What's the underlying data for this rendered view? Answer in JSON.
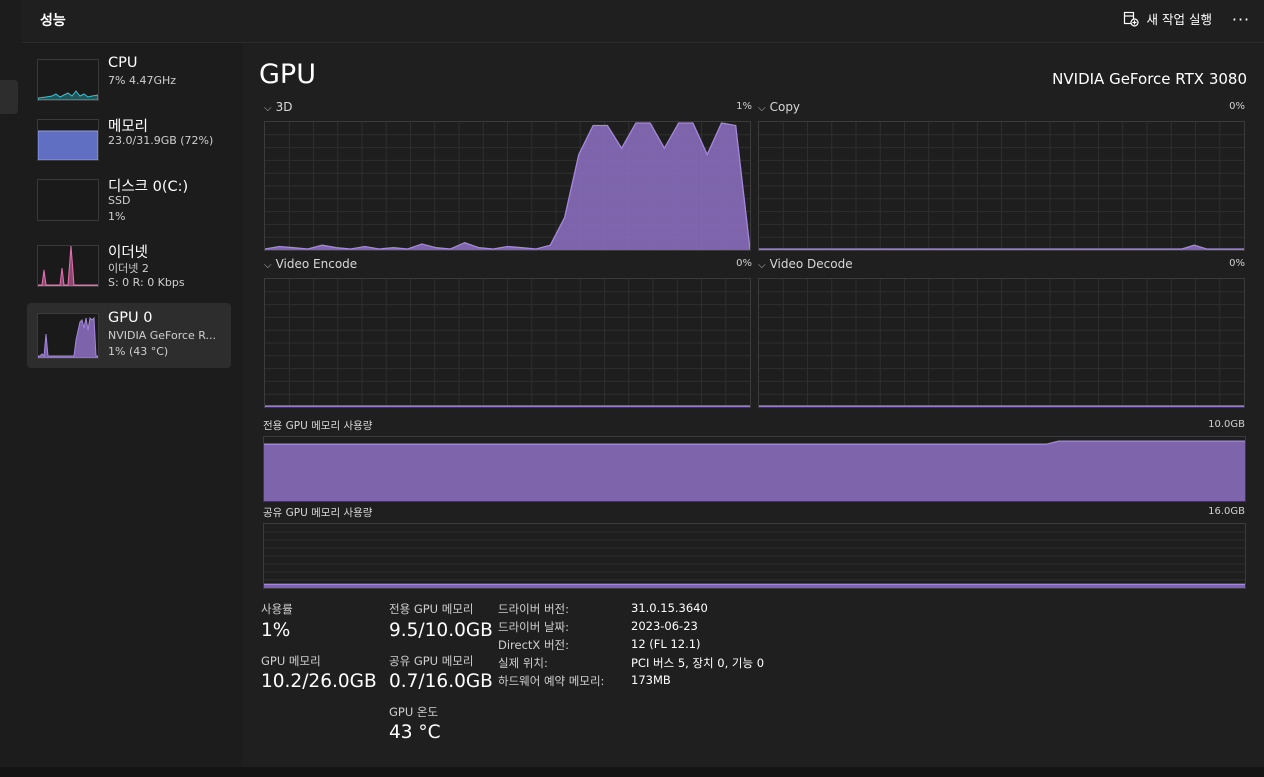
{
  "header": {
    "title": "성능",
    "run_new_task_label": "새 작업 실행",
    "more_label": "···"
  },
  "sidebar": {
    "items": [
      {
        "name": "CPU",
        "sub1": "7% 4.47GHz",
        "sub2": "",
        "color": "#35c3d0"
      },
      {
        "name": "메모리",
        "sub1": "23.0/31.9GB (72%)",
        "sub2": "",
        "color": "#6e7fe0"
      },
      {
        "name": "디스크 0(C:)",
        "sub1": "SSD",
        "sub2": "1%",
        "color": "#6abf4b"
      },
      {
        "name": "이더넷",
        "sub1": "이더넷 2",
        "sub2": "S: 0 R: 0 Kbps",
        "color": "#e96fb4"
      },
      {
        "name": "GPU 0",
        "sub1": "NVIDIA GeForce R...",
        "sub2": "1% (43 °C)",
        "color": "#a07ad8",
        "selected": true
      }
    ]
  },
  "main": {
    "title": "GPU",
    "model": "NVIDIA GeForce RTX 3080",
    "engines": [
      {
        "label": "3D",
        "percent": "1%"
      },
      {
        "label": "Copy",
        "percent": "0%"
      },
      {
        "label": "Video Encode",
        "percent": "0%"
      },
      {
        "label": "Video Decode",
        "percent": "0%"
      }
    ],
    "dedicated_memory": {
      "label": "전용 GPU 메모리 사용량",
      "max": "10.0GB"
    },
    "shared_memory": {
      "label": "공유 GPU 메모리 사용량",
      "max": "16.0GB"
    }
  },
  "stats": {
    "utilization": {
      "label": "사용률",
      "value": "1%"
    },
    "gpu_memory": {
      "label": "GPU 메모리",
      "value": "10.2/26.0GB"
    },
    "dedicated": {
      "label": "전용 GPU 메모리",
      "value": "9.5/10.0GB"
    },
    "shared": {
      "label": "공유 GPU 메모리",
      "value": "0.7/16.0GB"
    },
    "temperature": {
      "label": "GPU 온도",
      "value": "43 °C"
    }
  },
  "info": [
    {
      "key": "드라이버 버전:",
      "value": "31.0.15.3640"
    },
    {
      "key": "드라이버 날짜:",
      "value": "2023-06-23"
    },
    {
      "key": "DirectX 버전:",
      "value": "12 (FL 12.1)"
    },
    {
      "key": "실제 위치:",
      "value": "PCI 버스 5, 장치 0, 기능 0"
    },
    {
      "key": "하드웨어 예약 메모리:",
      "value": "173MB"
    }
  ],
  "colors": {
    "gpu_fill": "#8e71c4",
    "gpu_line": "#a586e0",
    "grid": "#2e2e2e",
    "background": "#1f1f1f"
  },
  "chart_data": [
    {
      "type": "area",
      "series": [
        {
          "name": "3D",
          "values": [
            0,
            2,
            1,
            0,
            3,
            1,
            0,
            2,
            0,
            1,
            0,
            4,
            1,
            0,
            5,
            1,
            0,
            2,
            1,
            0,
            3,
            25,
            75,
            98,
            98,
            80,
            100,
            100,
            80,
            100,
            100,
            75,
            100,
            98,
            0
          ]
        }
      ],
      "ylim": [
        0,
        100
      ]
    },
    {
      "type": "area",
      "series": [
        {
          "name": "Copy",
          "values": [
            0,
            0,
            0,
            0,
            0,
            0,
            0,
            0,
            0,
            0,
            0,
            0,
            0,
            0,
            0,
            0,
            0,
            0,
            0,
            0,
            0,
            0,
            0,
            0,
            0,
            0,
            0,
            0,
            0,
            0,
            0,
            0,
            0,
            0,
            0,
            3,
            0,
            0,
            0,
            0
          ]
        }
      ],
      "ylim": [
        0,
        100
      ]
    },
    {
      "type": "area",
      "series": [
        {
          "name": "Video Encode",
          "values": [
            0,
            0
          ]
        }
      ],
      "ylim": [
        0,
        100
      ]
    },
    {
      "type": "area",
      "series": [
        {
          "name": "Video Decode",
          "values": [
            0,
            0
          ]
        }
      ],
      "ylim": [
        0,
        100
      ]
    },
    {
      "type": "area",
      "series": [
        {
          "name": "전용 GPU 메모리 사용량",
          "values": [
            9.0,
            9.0,
            9.0,
            9.0,
            9.0,
            9.0,
            9.0,
            9.0,
            9.0,
            9.0,
            9.0,
            9.0,
            9.0,
            9.0,
            9.0,
            9.0,
            9.0,
            9.0,
            9.0,
            9.0,
            9.0,
            9.0,
            9.0,
            9.0,
            9.0,
            9.0,
            9.0,
            9.0,
            9.0,
            9.0,
            9.0,
            9.0,
            9.0,
            9.0,
            9.0,
            9.0,
            9.0,
            9.0,
            9.0,
            9.0,
            9.0,
            9.0,
            9.0,
            9.0,
            9.0,
            9.0,
            9.0,
            9.0,
            9.0,
            9.0,
            9.0,
            9.0,
            9.0,
            9.0,
            9.0,
            9.0,
            9.0,
            9.0,
            9.0,
            9.0,
            9.0,
            9.0,
            9.0,
            9.0,
            9.5,
            9.5,
            9.5,
            9.5,
            9.5,
            9.5,
            9.5,
            9.5,
            9.5,
            9.5,
            9.5,
            9.5,
            9.5,
            9.5,
            9.5,
            9.5
          ]
        }
      ],
      "ylim": [
        0,
        10
      ]
    },
    {
      "type": "area",
      "series": [
        {
          "name": "공유 GPU 메모리 사용량",
          "values": [
            0.7,
            0.7
          ]
        }
      ],
      "ylim": [
        0,
        16
      ]
    }
  ]
}
